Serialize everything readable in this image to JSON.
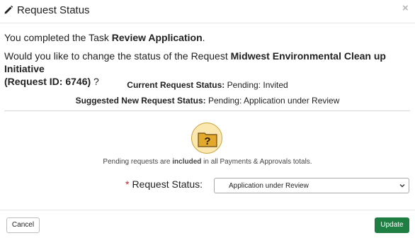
{
  "dialog": {
    "title": "Request Status",
    "close_glyph": "×",
    "title_icon": "pencil-icon"
  },
  "body": {
    "completed_prefix": "You completed the Task ",
    "task_name": "Review Application",
    "completed_suffix": ".",
    "question_prefix": "Would you like to change the status of the Request ",
    "request_name": "Midwest Environmental Clean up Initiative",
    "request_id_label": "(Request ID: 6746)",
    "question_suffix": " ?",
    "current_label": "Current Request Status:",
    "current_value": " Pending: Invited",
    "suggested_label": "Suggested New Request Status:",
    "suggested_value": " Pending: Application under Review",
    "note_prefix": "Pending requests are ",
    "note_bold": "included",
    "note_suffix": " in all Payments & Approvals totals."
  },
  "form": {
    "required_marker": "*",
    "status_label": "Request Status:",
    "status_selected": "Application under Review"
  },
  "footer": {
    "cancel_label": "Cancel",
    "update_label": "Update"
  },
  "colors": {
    "update_button": "#1f7f42",
    "required_star": "#c62828",
    "status_icon_bg": "#fbe7b0",
    "status_icon_folder": "#e2a92c"
  }
}
